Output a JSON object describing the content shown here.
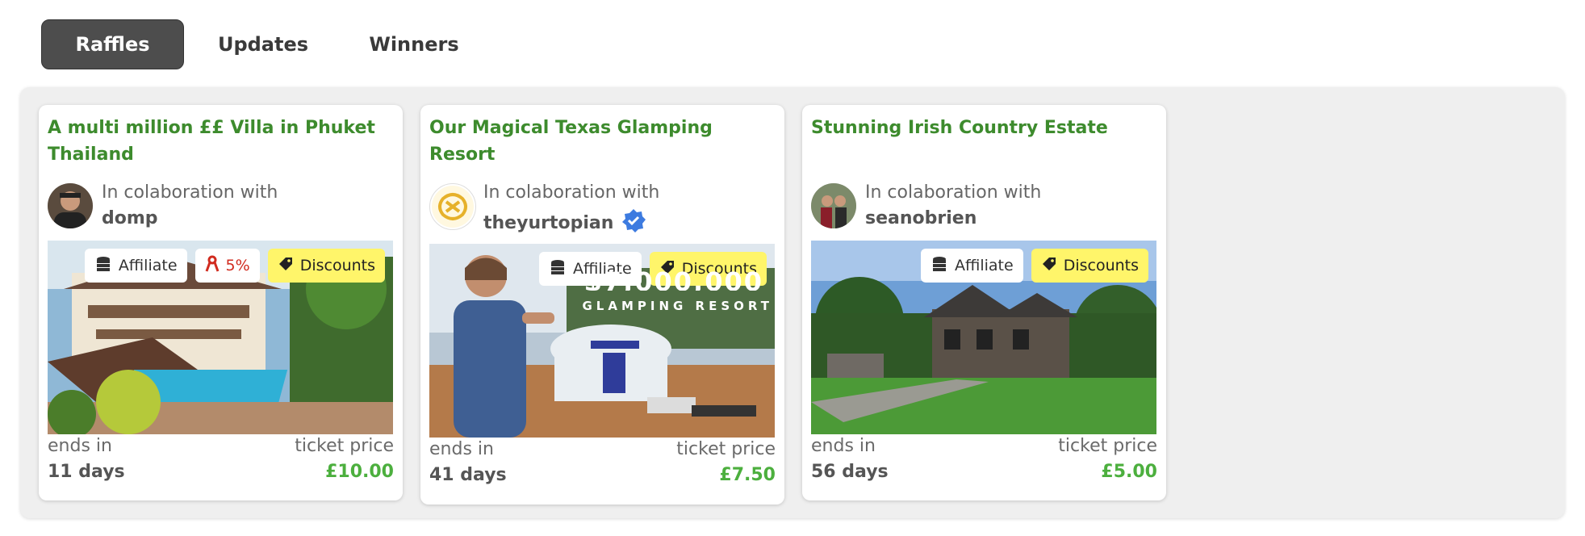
{
  "tabs": [
    {
      "label": "Raffles",
      "active": true
    },
    {
      "label": "Updates",
      "active": false
    },
    {
      "label": "Winners",
      "active": false
    }
  ],
  "collab_label": "In colaboration with",
  "footer": {
    "ends_label": "ends in",
    "price_label": "ticket price"
  },
  "badges": {
    "affiliate": "Affiliate",
    "discounts": "Discounts"
  },
  "cards": [
    {
      "title": "A multi million ££ Villa in Phuket Thailand",
      "host": "domp",
      "verified": false,
      "commission": "5%",
      "ends_in": "11 days",
      "ticket_price": "£10.00",
      "image_icon": "villa-pool-photo"
    },
    {
      "title": "Our Magical Texas Glamping Resort",
      "host": "theyurtopian",
      "verified": true,
      "ends_in": "41 days",
      "ticket_price": "£7.50",
      "image_icon": "yurt-glamping-photo",
      "image_overlay_text": "$7,000,000",
      "image_overlay_subtext": "GLAMPING RESORT"
    },
    {
      "title": "Stunning Irish Country Estate",
      "host": "seanobrien",
      "verified": false,
      "ends_in": "56 days",
      "ticket_price": "£5.00",
      "image_icon": "country-house-photo"
    }
  ],
  "colors": {
    "title_green": "#3d8b2d",
    "price_green": "#4caf3e",
    "discount_yellow": "#fff56a",
    "tab_active": "#4d4d4d"
  }
}
